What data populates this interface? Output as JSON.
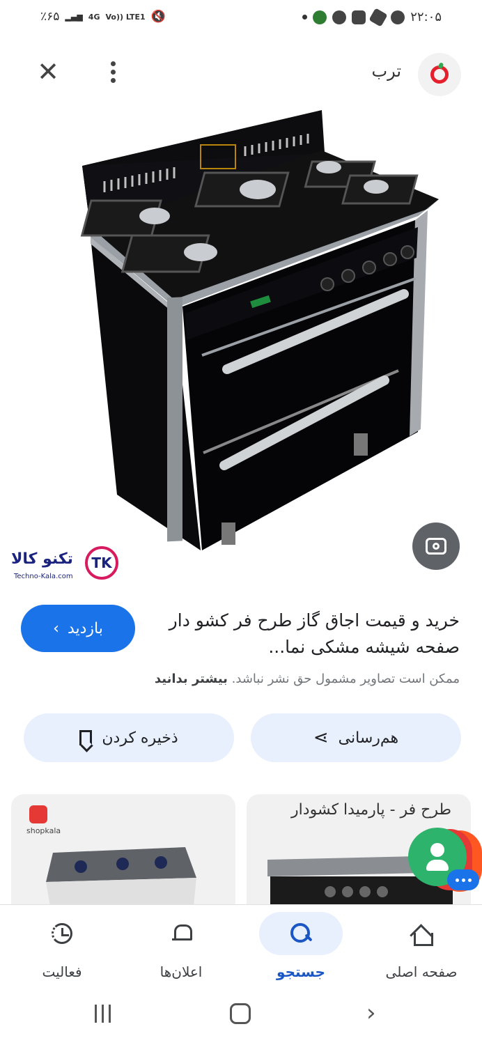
{
  "status_bar": {
    "battery": "٪۶۵",
    "network": "4G",
    "volte": "Vo)) LTE1",
    "time": "۲۲:۰۵"
  },
  "top_bar": {
    "site_name": "ترب",
    "close_icon": "close-icon",
    "more_icon": "more-vert-icon"
  },
  "product": {
    "watermark_text": "تکنو کالا",
    "watermark_url": "Techno-Kala.com",
    "watermark_badge": "TK"
  },
  "result": {
    "title": "خرید و قیمت اجاق گاز طرح فر کشو دار صفحه شیشه مشکی نما...",
    "visit_label": "بازدید",
    "copyright_text": "ممکن است تصاویر مشمول حق نشر نباشد.",
    "learn_more": "بیشتر بدانید"
  },
  "actions": {
    "share_label": "هم‌رسانی",
    "save_label": "ذخیره کردن"
  },
  "related": {
    "right_caption": "طرح فر - پارمیدا کشودار",
    "left_brand": "shopkala"
  },
  "bottom_nav": {
    "home": "صفحه اصلی",
    "search": "جستجو",
    "notifications": "اعلان‌ها",
    "activity": "فعالیت",
    "active": "search"
  },
  "colors": {
    "accent": "#1a73e8",
    "chip_bg": "#e8f0fe",
    "fab_green": "#2db36b"
  }
}
